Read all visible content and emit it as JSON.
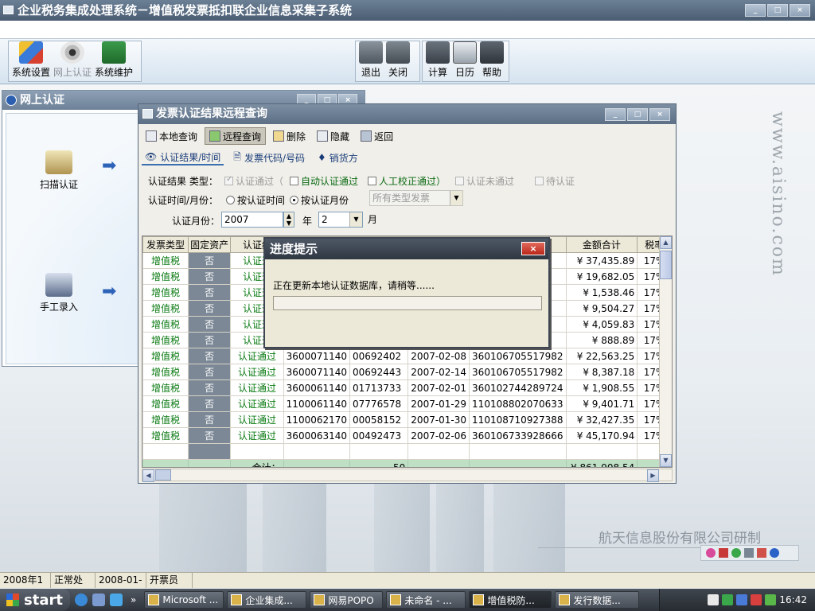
{
  "app": {
    "title": "企业税务集成处理系统－增值税发票抵扣联企业信息采集子系统",
    "window_buttons": [
      "_",
      "□",
      "×"
    ]
  },
  "toolbar": {
    "left": [
      {
        "label": "系统设置",
        "icon": "settings-icon",
        "enabled": true
      },
      {
        "label": "网上认证",
        "icon": "eye-icon",
        "enabled": false
      },
      {
        "label": "系统维护",
        "icon": "maintenance-icon",
        "enabled": true
      }
    ],
    "mid": [
      {
        "label": "退出",
        "icon": "exit-icon"
      },
      {
        "label": "关闭",
        "icon": "close-icon"
      }
    ],
    "right": [
      {
        "label": "计算",
        "icon": "calculator-icon"
      },
      {
        "label": "日历",
        "icon": "calendar-icon"
      },
      {
        "label": "帮助",
        "icon": "help-icon"
      }
    ]
  },
  "online_panel": {
    "title": "网上认证",
    "items": [
      {
        "label": "扫描认证",
        "icon": "scanner-icon"
      },
      {
        "label": "手工录入",
        "icon": "manual-entry-icon"
      }
    ],
    "arrow_icon": "arrow-right-icon"
  },
  "query_window": {
    "title": "发票认证结果远程查询",
    "tools": [
      {
        "label": "本地查询",
        "icon": "local-query-icon",
        "active": false
      },
      {
        "label": "远程查询",
        "icon": "remote-query-icon",
        "active": true
      },
      {
        "label": "删除",
        "icon": "delete-icon",
        "active": false
      },
      {
        "label": "隐藏",
        "icon": "hide-icon",
        "active": false
      },
      {
        "label": "返回",
        "icon": "return-icon",
        "active": false
      }
    ],
    "tabs": [
      {
        "label": "认证结果/时间",
        "icon": "eye-icon",
        "active": true
      },
      {
        "label": "发票代码/号码",
        "icon": "document-icon",
        "active": false
      },
      {
        "label": "销货方",
        "icon": "seller-icon",
        "active": false
      }
    ],
    "filters": {
      "result_label": "认证结果 类型：",
      "options": [
        {
          "label": "认证通过（",
          "checked": true,
          "disabled": true
        },
        {
          "label": "自动认证通过",
          "checked": false,
          "disabled": false
        },
        {
          "label": "人工校正通过）",
          "checked": false,
          "disabled": false
        },
        {
          "label": "认证未通过",
          "checked": false,
          "disabled": true
        },
        {
          "label": "待认证",
          "checked": false,
          "disabled": true
        }
      ],
      "time_label": "认证时间/月份：",
      "radio_time": "按认证时间",
      "radio_month": "按认证月份",
      "selected": "month",
      "invoice_type_placeholder": "所有类型发票",
      "month_label": "认证月份：",
      "year_value": "2007",
      "year_unit": "年",
      "month_value": "2",
      "month_unit": "月"
    },
    "table": {
      "columns": [
        "发票类型",
        "固定资产",
        "认证结",
        "",
        "",
        "",
        "",
        "金额合计",
        "税率"
      ],
      "rows": [
        [
          "增值税",
          "否",
          "认证通",
          "",
          "",
          "",
          "",
          "¥ 37,435.89",
          "17%"
        ],
        [
          "增值税",
          "否",
          "认证通",
          "",
          "",
          "",
          "",
          "¥ 19,682.05",
          "17%"
        ],
        [
          "增值税",
          "否",
          "认证通",
          "",
          "",
          "",
          "",
          "¥ 1,538.46",
          "17%"
        ],
        [
          "增值税",
          "否",
          "认证通",
          "",
          "",
          "",
          "",
          "¥ 9,504.27",
          "17%"
        ],
        [
          "增值税",
          "否",
          "认证通",
          "",
          "",
          "",
          "",
          "¥ 4,059.83",
          "17%"
        ],
        [
          "增值税",
          "否",
          "认证通",
          "",
          "",
          "",
          "",
          "¥ 888.89",
          "17%"
        ],
        [
          "增值税",
          "否",
          "认证通过",
          "3600071140",
          "00692402",
          "2007-02-08",
          "360106705517982",
          "¥ 22,563.25",
          "17%"
        ],
        [
          "增值税",
          "否",
          "认证通过",
          "3600071140",
          "00692443",
          "2007-02-14",
          "360106705517982",
          "¥ 8,387.18",
          "17%"
        ],
        [
          "增值税",
          "否",
          "认证通过",
          "3600061140",
          "01713733",
          "2007-02-01",
          "360102744289724",
          "¥ 1,908.55",
          "17%"
        ],
        [
          "增值税",
          "否",
          "认证通过",
          "1100061140",
          "07776578",
          "2007-01-29",
          "110108802070633",
          "¥ 9,401.71",
          "17%"
        ],
        [
          "增值税",
          "否",
          "认证通过",
          "1100062170",
          "00058152",
          "2007-01-30",
          "110108710927388",
          "¥ 32,427.35",
          "17%"
        ],
        [
          "增值税",
          "否",
          "认证通过",
          "3600063140",
          "00492473",
          "2007-02-06",
          "360106733928666",
          "¥ 45,170.94",
          "17%"
        ]
      ],
      "summary": {
        "label": "合计：",
        "count": "50",
        "amount": "¥ 861,908.54"
      }
    }
  },
  "progress_dialog": {
    "title": "进度提示",
    "close": "×",
    "message": "正在更新本地认证数据库，请稍等......",
    "progress": 0
  },
  "watermark": "www.aisino.com",
  "company": "航天信息股份有限公司研制",
  "statusbar": [
    "2008年1月",
    "正常处理",
    "2008-01-17",
    "开票员"
  ],
  "taskbar": {
    "start": "start",
    "quicklaunch_more": "»",
    "tasks": [
      {
        "label": "Microsoft ...",
        "active": false
      },
      {
        "label": "企业集成...",
        "active": false
      },
      {
        "label": "网易POPO",
        "active": false
      },
      {
        "label": "未命名 - ...",
        "active": false
      },
      {
        "label": "增值税防...",
        "active": true
      },
      {
        "label": "发行数据...",
        "active": false
      }
    ],
    "clock": "16:42"
  }
}
